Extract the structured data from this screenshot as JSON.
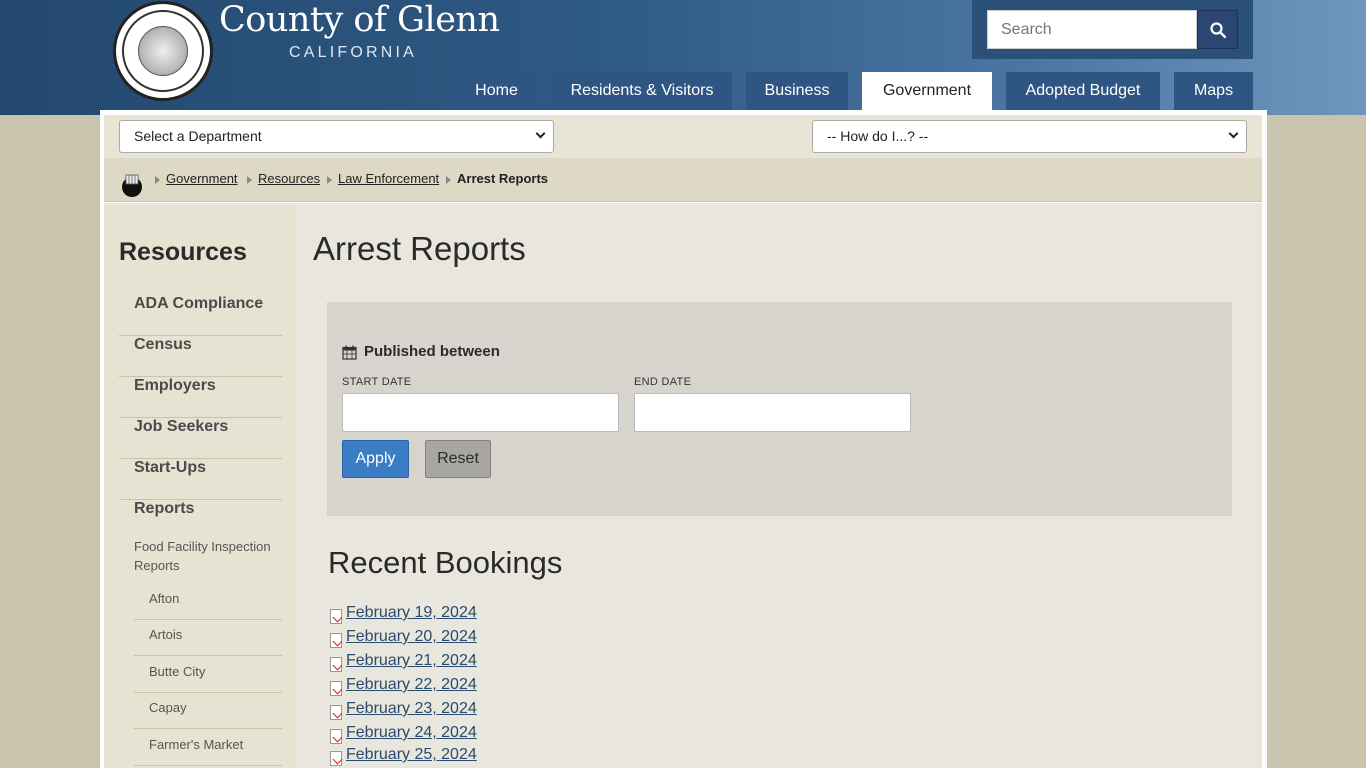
{
  "header": {
    "site_title": "County of Glenn",
    "site_subtitle": "CALIFORNIA",
    "search_placeholder": "Search"
  },
  "nav": {
    "items": [
      {
        "label": "Home"
      },
      {
        "label": "Residents & Visitors"
      },
      {
        "label": "Business"
      },
      {
        "label": "Government",
        "active": true
      },
      {
        "label": "Adopted Budget"
      },
      {
        "label": "Maps"
      }
    ]
  },
  "toolbar": {
    "department_select": "Select a Department",
    "howdoi_select": "-- How do I...? --"
  },
  "breadcrumb": [
    "Government",
    "Resources",
    "Law Enforcement",
    "Arrest Reports"
  ],
  "sidebar": {
    "title": "Resources",
    "items": [
      "ADA Compliance",
      "Census",
      "Employers",
      "Job Seekers",
      "Start-Ups",
      "Reports"
    ],
    "sub_heading": "Food Facility Inspection Reports",
    "sub_items": [
      "Afton",
      "Artois",
      "Butte City",
      "Capay",
      "Farmer's Market"
    ]
  },
  "main": {
    "page_title": "Arrest Reports",
    "filter": {
      "label": "Published between",
      "start_label": "START DATE",
      "end_label": "END DATE",
      "apply_label": "Apply",
      "reset_label": "Reset"
    },
    "section_title": "Recent Bookings",
    "reports": [
      "February 19, 2024",
      "February 20, 2024",
      "February 21, 2024",
      "February 22, 2024",
      "February 23, 2024",
      "February 24, 2024",
      "February 25, 2024"
    ]
  },
  "colors": {
    "header_dark": "#23486e",
    "nav_bg": "#2f5682",
    "apply_blue": "#3b7dc4",
    "page_bg": "#c9c4ae"
  }
}
